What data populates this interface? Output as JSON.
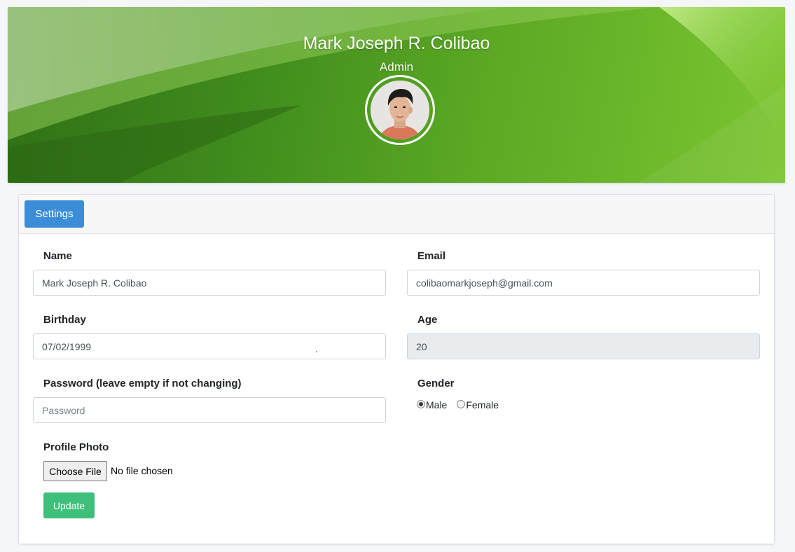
{
  "profile": {
    "name": "Mark Joseph R. Colibao",
    "role": "Admin"
  },
  "tabs": {
    "settings": "Settings"
  },
  "form": {
    "name": {
      "label": "Name",
      "value": "Mark Joseph R. Colibao"
    },
    "email": {
      "label": "Email",
      "value": "colibaomarkjoseph@gmail.com"
    },
    "birthday": {
      "label": "Birthday",
      "value": "07/02/1999"
    },
    "age": {
      "label": "Age",
      "value": "20"
    },
    "password": {
      "label": "Password (leave empty if not changing)",
      "placeholder": "Password"
    },
    "gender": {
      "label": "Gender",
      "options": [
        "Male",
        "Female"
      ],
      "selected": "Male"
    },
    "photo": {
      "label": "Profile Photo",
      "button": "Choose File",
      "status": "No file chosen"
    },
    "submit": "Update"
  },
  "colors": {
    "header_green": "#5aa824",
    "settings_blue": "#3c8dd8",
    "update_green": "#3fc07a",
    "readonly_gray": "#e9ecef"
  }
}
